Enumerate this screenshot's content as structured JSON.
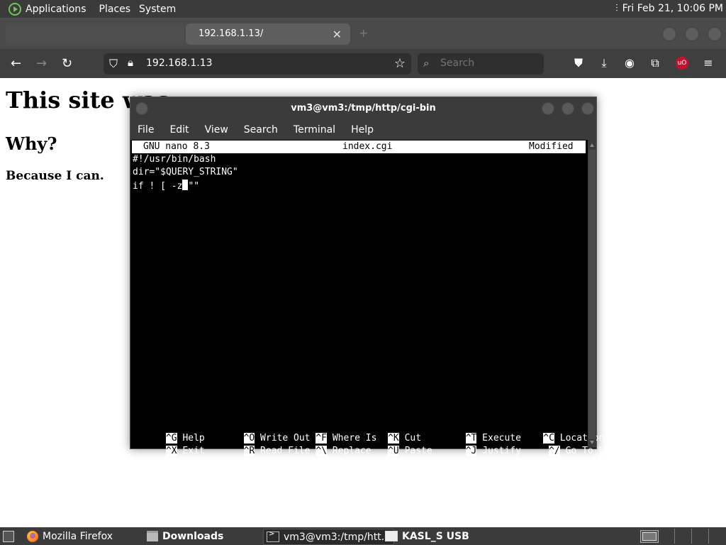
{
  "top_panel": {
    "menu": [
      "Applications",
      "Places",
      "System"
    ],
    "clock": "Fri Feb 21, 10:06 PM"
  },
  "firefox": {
    "tab_title": "192.168.1.13/",
    "url": "192.168.1.13",
    "search_placeholder": "Search",
    "close_tab": "✕",
    "new_tab": "+"
  },
  "page": {
    "h1": "This site was",
    "h2": "Why?",
    "p": "Because I can."
  },
  "terminal": {
    "title": "vm3@vm3:/tmp/http/cgi-bin",
    "menu": [
      "File",
      "Edit",
      "View",
      "Search",
      "Terminal",
      "Help"
    ],
    "nano": {
      "left": "GNU nano 8.3",
      "center": "index.cgi",
      "right": "Modified",
      "lines": [
        "#!/usr/bin/bash",
        "dir=\"$QUERY_STRING\"",
        "if ! [ -z",
        "\"\""
      ],
      "shortcuts": [
        [
          {
            "key": "^G",
            "label": "Help"
          },
          {
            "key": "^O",
            "label": "Write Out"
          },
          {
            "key": "^F",
            "label": "Where Is"
          },
          {
            "key": "^K",
            "label": "Cut"
          },
          {
            "key": "^T",
            "label": "Execute"
          },
          {
            "key": "^C",
            "label": "Location"
          }
        ],
        [
          {
            "key": "^X",
            "label": "Exit"
          },
          {
            "key": "^R",
            "label": "Read File"
          },
          {
            "key": "^\\",
            "label": "Replace"
          },
          {
            "key": "^U",
            "label": "Paste"
          },
          {
            "key": "^J",
            "label": "Justify"
          },
          {
            "key": "^/",
            "label": "Go To Line"
          }
        ]
      ]
    }
  },
  "taskbar": {
    "items": [
      "Mozilla Firefox",
      "Downloads",
      "vm3@vm3:/tmp/htt...",
      "KASL_S USB"
    ]
  }
}
